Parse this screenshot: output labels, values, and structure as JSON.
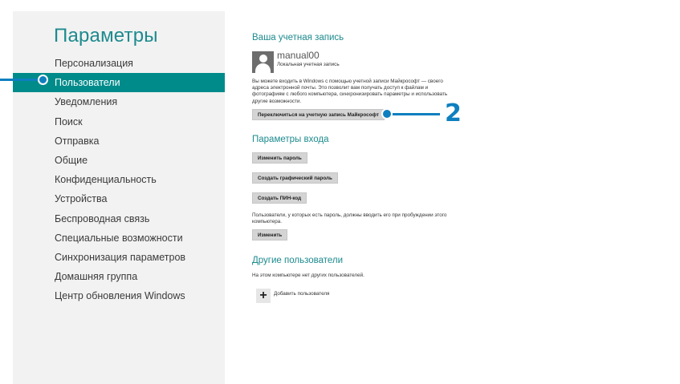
{
  "app": {
    "title": "Параметры"
  },
  "nav": {
    "items": [
      {
        "label": "Персонализация"
      },
      {
        "label": "Пользователи",
        "selected": true
      },
      {
        "label": "Уведомления"
      },
      {
        "label": "Поиск"
      },
      {
        "label": "Отправка"
      },
      {
        "label": "Общие"
      },
      {
        "label": "Конфиденциальность"
      },
      {
        "label": "Устройства"
      },
      {
        "label": "Беспроводная связь"
      },
      {
        "label": "Специальные возможности"
      },
      {
        "label": "Синхронизация параметров"
      },
      {
        "label": "Домашняя группа"
      },
      {
        "label": "Центр обновления Windows"
      }
    ]
  },
  "account": {
    "section_title": "Ваша учетная запись",
    "user_name": "manual00",
    "account_type": "Локальная учетная запись",
    "description": "Вы можете входить в Windows с помощью учетной записи Майкрософт — своего адреса электронной почты. Это позволит вам получать доступ к файлам и фотографиям с любого компьютера, синхронизировать параметры и использовать другие возможности.",
    "switch_button": "Переключиться на учетную запись Майкрософт"
  },
  "signin": {
    "section_title": "Параметры входа",
    "change_password_button": "Изменить пароль",
    "picture_password_button": "Создать графический пароль",
    "pin_button": "Создать ПИН-код",
    "wake_text": "Пользователи, у которых есть пароль, должны вводить его при пробуждении этого компьютера.",
    "change_button": "Изменить"
  },
  "others": {
    "section_title": "Другие пользователи",
    "none_text": "На этом компьютере нет других пользователей.",
    "add_user_label": "Добавить пользователя"
  },
  "callouts": {
    "second_number": "2"
  },
  "colors": {
    "accent": "#1d8a8e",
    "selected_bg": "#008b8b",
    "callout": "#0e7fbf",
    "pane_bg": "#f2f2f2",
    "button_bg": "#d4d4d4"
  },
  "icons": {
    "avatar": "user-avatar-icon",
    "add": "plus-icon"
  }
}
